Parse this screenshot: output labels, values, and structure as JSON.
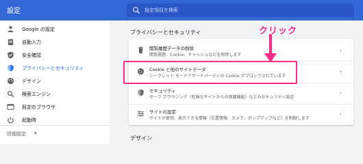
{
  "header": {
    "title": "設定",
    "search_placeholder": "設定項目を検索"
  },
  "sidebar": {
    "items": [
      {
        "label": "Google の設定",
        "icon": "person-icon"
      },
      {
        "label": "自動入力",
        "icon": "clipboard-icon"
      },
      {
        "label": "安全確認",
        "icon": "shield-check-icon"
      },
      {
        "label": "プライバシーとセキュリティ",
        "icon": "shield-icon",
        "active": true
      },
      {
        "label": "デザイン",
        "icon": "palette-icon"
      },
      {
        "label": "検索エンジン",
        "icon": "search-icon"
      },
      {
        "label": "既定のブラウザ",
        "icon": "browser-icon"
      },
      {
        "label": "起動時",
        "icon": "power-icon"
      }
    ],
    "advanced_label": "詳細設定"
  },
  "main": {
    "section_title": "プライバシーとセキュリティ",
    "rows": [
      {
        "title": "閲覧履歴データの削除",
        "subtitle": "閲覧履歴、Cookie、キャッシュなどを削除します",
        "icon": "trash-icon"
      },
      {
        "title": "Cookie と他のサイトデータ",
        "subtitle": "シークレット モードでサードパーティの Cookie がブロックされています",
        "icon": "cookie-icon"
      },
      {
        "title": "セキュリティ",
        "subtitle": "セーフ ブラウジング（危険なサイトからの保護機能）などのセキュリティ設定",
        "icon": "security-shield-icon"
      },
      {
        "title": "サイトの設定",
        "subtitle": "サイトが使用、表示できる情報（位置情報、カメラ、ポップアップなど）を制御します",
        "icon": "sliders-icon"
      }
    ],
    "next_section_title": "デザイン"
  },
  "annotation": {
    "text": "クリック",
    "color": "#ff2a8a"
  },
  "colors": {
    "header": "#3367d6",
    "accent": "#1a73e8",
    "highlight": "#ff2a8a"
  }
}
